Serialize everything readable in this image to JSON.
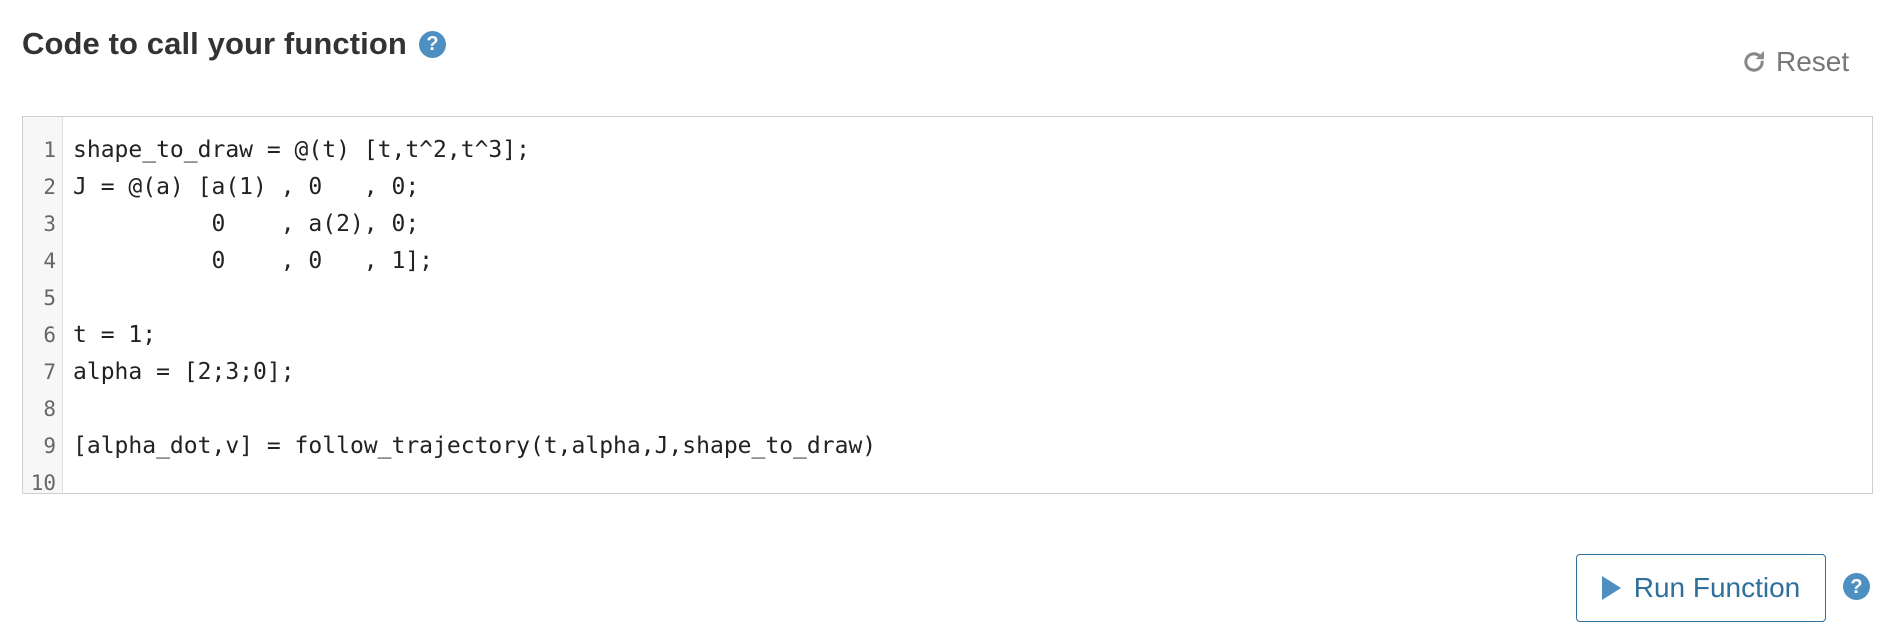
{
  "header": {
    "title": "Code to call your function",
    "help_icon": "question-circle-icon",
    "reset_label": "Reset",
    "reset_icon": "refresh-icon"
  },
  "editor": {
    "lines": [
      "shape_to_draw = @(t) [t,t^2,t^3];",
      "J = @(a) [a(1) , 0   , 0;",
      "          0    , a(2), 0;",
      "          0    , 0   , 1];",
      "",
      "t = 1;",
      "alpha = [2;3;0];",
      "",
      "[alpha_dot,v] = follow_trajectory(t,alpha,J,shape_to_draw)",
      ""
    ],
    "line_numbers": [
      "1",
      "2",
      "3",
      "4",
      "5",
      "6",
      "7",
      "8",
      "9",
      "10"
    ]
  },
  "footer": {
    "run_label": "Run Function",
    "run_icon": "play-icon",
    "help_icon": "question-circle-icon"
  },
  "colors": {
    "accent": "#4e8fc1",
    "button_text": "#2f6f9b",
    "title_text": "#333333",
    "muted_text": "#777777"
  }
}
